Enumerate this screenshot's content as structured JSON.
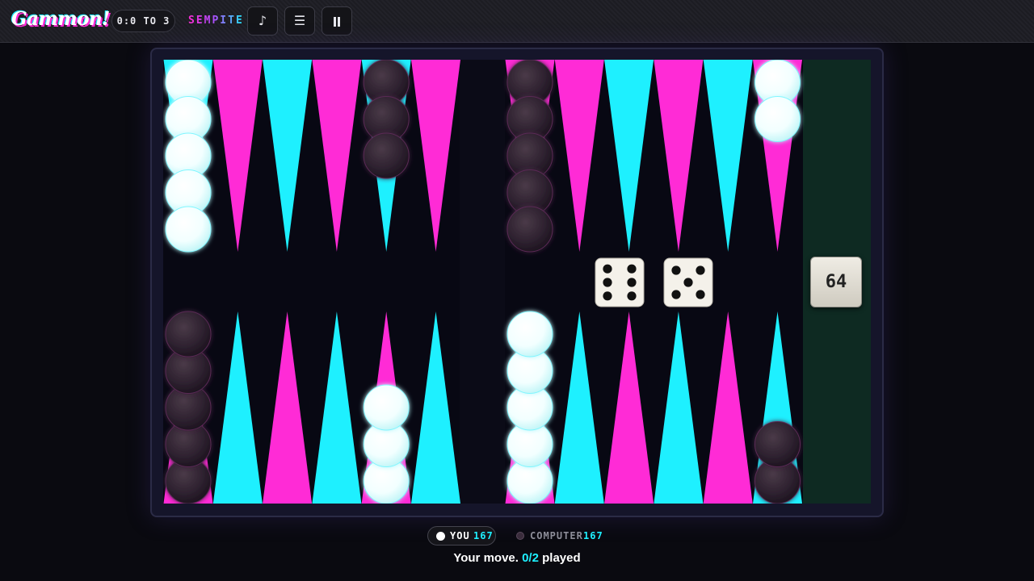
{
  "header": {
    "logo": "Gammon!",
    "match_score": "0:0 TO 3",
    "brand": "SEMPITE",
    "music_icon": "♪",
    "menu_icon": "☰",
    "pause_icon": "⏸"
  },
  "colors": {
    "magenta": "#ff2bd6",
    "cyan": "#1ef0ff",
    "board_bg": "#080813",
    "bear_off_tray": "#0e2a22",
    "white_checker": "#e8ffff",
    "dark_checker": "#2a1e2c"
  },
  "board": {
    "top_points": [
      {
        "point": 13,
        "color": "cyan",
        "checkers": {
          "player": "white",
          "count": 5
        }
      },
      {
        "point": 14,
        "color": "magenta",
        "checkers": null
      },
      {
        "point": 15,
        "color": "cyan",
        "checkers": null
      },
      {
        "point": 16,
        "color": "magenta",
        "checkers": null
      },
      {
        "point": 17,
        "color": "cyan",
        "checkers": {
          "player": "dark",
          "count": 3
        }
      },
      {
        "point": 18,
        "color": "magenta",
        "checkers": null
      },
      {
        "point": 19,
        "color": "magenta",
        "checkers": {
          "player": "dark",
          "count": 5
        }
      },
      {
        "point": 20,
        "color": "magenta",
        "checkers": null
      },
      {
        "point": 21,
        "color": "cyan",
        "checkers": null
      },
      {
        "point": 22,
        "color": "magenta",
        "checkers": null
      },
      {
        "point": 23,
        "color": "cyan",
        "checkers": null
      },
      {
        "point": 24,
        "color": "magenta",
        "checkers": {
          "player": "white",
          "count": 2
        }
      }
    ],
    "bottom_points": [
      {
        "point": 12,
        "color": "magenta",
        "checkers": {
          "player": "dark",
          "count": 5
        }
      },
      {
        "point": 11,
        "color": "cyan",
        "checkers": null
      },
      {
        "point": 10,
        "color": "magenta",
        "checkers": null
      },
      {
        "point": 9,
        "color": "cyan",
        "checkers": null
      },
      {
        "point": 8,
        "color": "magenta",
        "checkers": {
          "player": "white",
          "count": 3
        }
      },
      {
        "point": 7,
        "color": "cyan",
        "checkers": null
      },
      {
        "point": 6,
        "color": "magenta",
        "checkers": {
          "player": "white",
          "count": 5
        }
      },
      {
        "point": 5,
        "color": "cyan",
        "checkers": null
      },
      {
        "point": 4,
        "color": "magenta",
        "checkers": null
      },
      {
        "point": 3,
        "color": "cyan",
        "checkers": null
      },
      {
        "point": 2,
        "color": "magenta",
        "checkers": null
      },
      {
        "point": 1,
        "color": "cyan",
        "checkers": {
          "player": "dark",
          "count": 2
        }
      }
    ],
    "dice": [
      6,
      5
    ],
    "doubling_cube": "64"
  },
  "footer": {
    "you_label": "YOU",
    "you_pips": "167",
    "computer_label": "COMPUTER",
    "computer_pips": "167",
    "status_prefix": "Your move.",
    "moves_played": "0/2",
    "status_suffix": "played"
  }
}
